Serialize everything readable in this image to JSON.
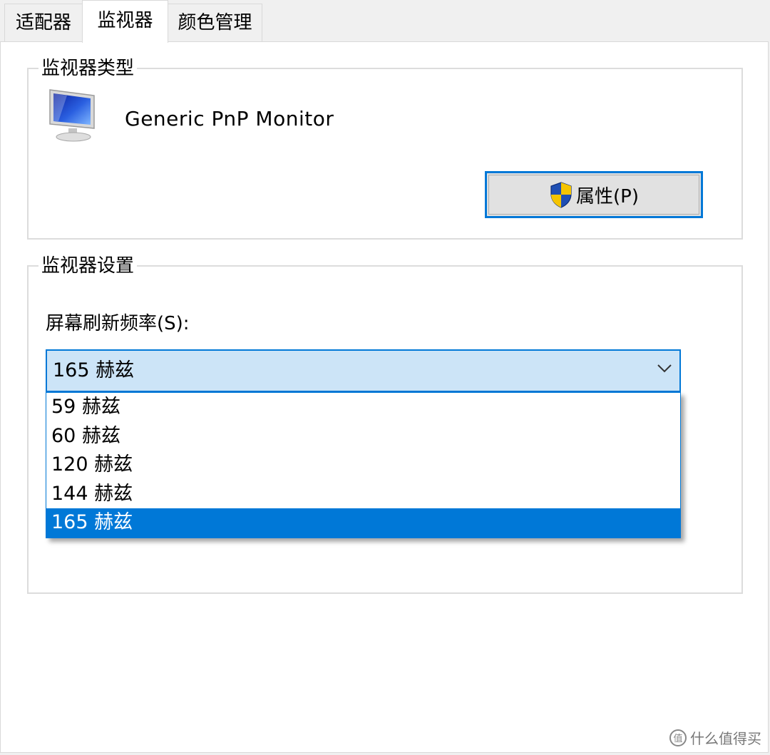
{
  "tabs": [
    {
      "label": "适配器",
      "active": false
    },
    {
      "label": "监视器",
      "active": true
    },
    {
      "label": "颜色管理",
      "active": false
    }
  ],
  "monitor_type": {
    "group_title": "监视器类型",
    "monitor_name": "Generic PnP Monitor",
    "icon": "monitor-icon",
    "properties_button": {
      "label": "属性(P)",
      "icon": "uac-shield-icon"
    }
  },
  "monitor_settings": {
    "group_title": "监视器设置",
    "refresh_rate_label": "屏幕刷新频率(S):",
    "selected_value": "165 赫兹",
    "options": [
      "59 赫兹",
      "60 赫兹",
      "120 赫兹",
      "144 赫兹",
      "165 赫兹"
    ],
    "highlighted_option": "165 赫兹"
  },
  "watermark": {
    "text": "什么值得买",
    "icon": "smzdm-logo-icon"
  },
  "colors": {
    "accent": "#0078d7",
    "combo_bg": "#cce4f7",
    "window_bg": "#f0f0f0"
  }
}
